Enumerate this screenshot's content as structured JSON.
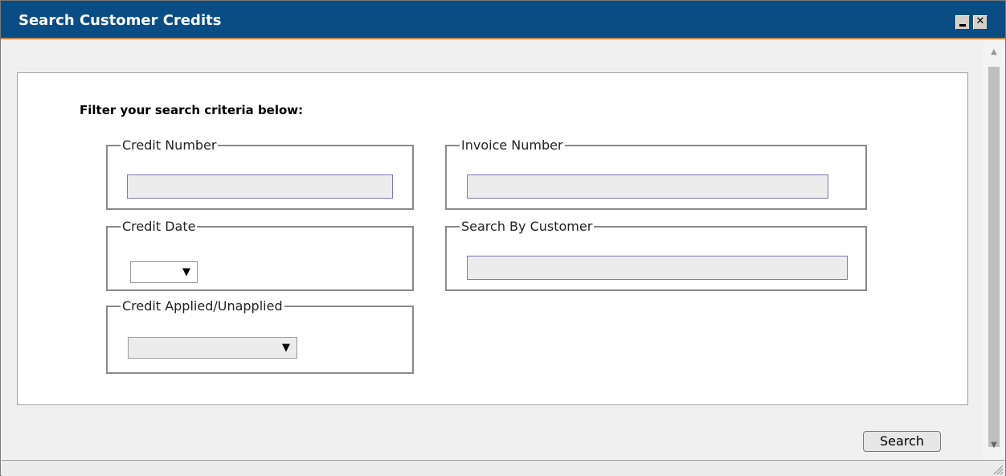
{
  "window": {
    "title": "Search Customer Credits"
  },
  "panel": {
    "heading": "Filter your search criteria below:",
    "credit_number": {
      "label": "Credit Number",
      "value": ""
    },
    "invoice_number": {
      "label": "Invoice Number",
      "value": ""
    },
    "credit_date": {
      "label": "Credit Date",
      "selected": ""
    },
    "search_by_customer": {
      "label": "Search By Customer",
      "value": ""
    },
    "credit_applied": {
      "label": "Credit Applied/Unapplied",
      "selected": ""
    }
  },
  "actions": {
    "search_label": "Search"
  },
  "icons": {
    "minimize": "minimize-icon",
    "close": "close-icon",
    "dropdown": "triangle-down-icon",
    "resize": "resize-grip-icon"
  },
  "colors": {
    "titlebar": "#0a4c84",
    "input_border": "#7a78b4"
  }
}
